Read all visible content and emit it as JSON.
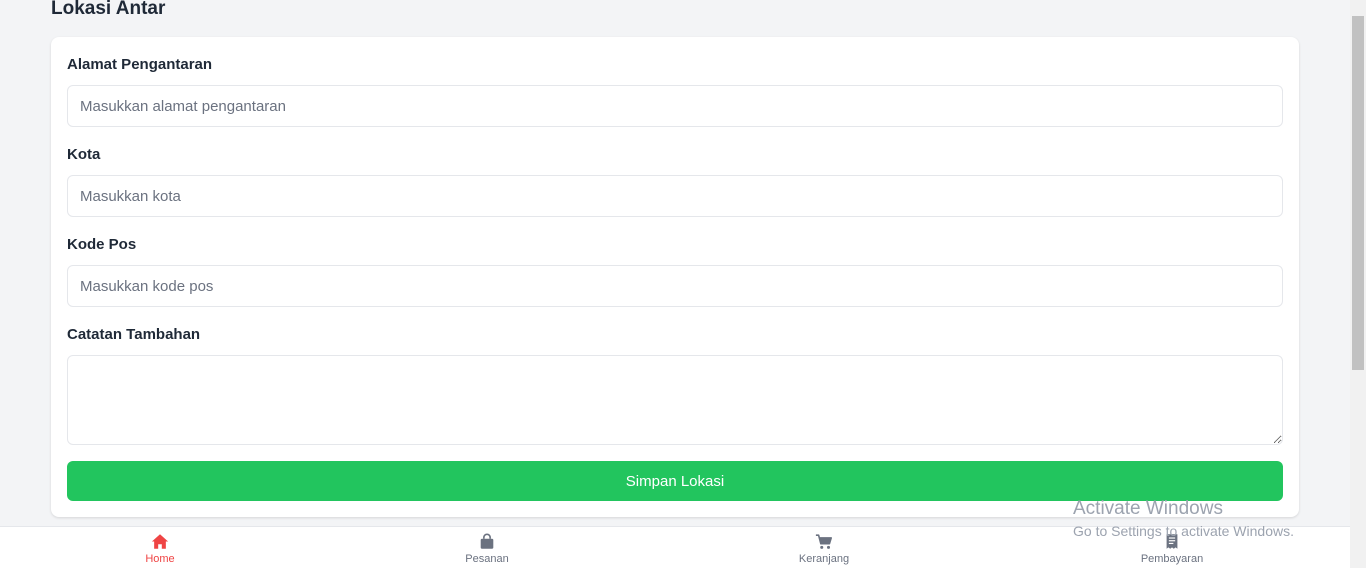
{
  "page": {
    "title": "Lokasi Antar"
  },
  "form": {
    "address": {
      "label": "Alamat Pengantaran",
      "placeholder": "Masukkan alamat pengantaran",
      "value": ""
    },
    "city": {
      "label": "Kota",
      "placeholder": "Masukkan kota",
      "value": ""
    },
    "postal_code": {
      "label": "Kode Pos",
      "placeholder": "Masukkan kode pos",
      "value": ""
    },
    "notes": {
      "label": "Catatan Tambahan",
      "value": ""
    },
    "submit_label": "Simpan Lokasi"
  },
  "bottom_nav": {
    "items": [
      {
        "label": "Home",
        "icon": "home-icon",
        "active": true
      },
      {
        "label": "Pesanan",
        "icon": "shopping-bag-icon",
        "active": false
      },
      {
        "label": "Keranjang",
        "icon": "cart-icon",
        "active": false
      },
      {
        "label": "Pembayaran",
        "icon": "receipt-icon",
        "active": false
      }
    ]
  },
  "watermark": {
    "title": "Activate Windows",
    "subtitle": "Go to Settings to activate Windows."
  },
  "colors": {
    "accent": "#22c55e",
    "active_nav": "#ef4444",
    "background": "#f3f4f6"
  }
}
